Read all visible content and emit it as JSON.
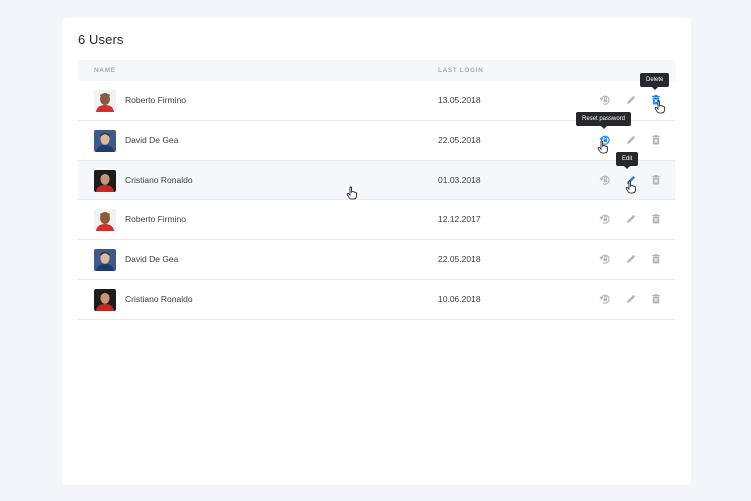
{
  "card": {
    "title": "6 Users"
  },
  "table": {
    "columns": {
      "name": "NAME",
      "last_login": "LAST LOGIN"
    },
    "rows": [
      {
        "name": "Roberto Firmino",
        "last_login": "13.05.2018"
      },
      {
        "name": "David De Gea",
        "last_login": "22.05.2018"
      },
      {
        "name": "Cristiano Ronaldo",
        "last_login": "01.03.2018"
      },
      {
        "name": "Roberto Firmino",
        "last_login": "12.12.2017"
      },
      {
        "name": "David De Gea",
        "last_login": "22.05.2018"
      },
      {
        "name": "Cristiano Ronaldo",
        "last_login": "10.06.2018"
      }
    ],
    "hover_row_index": 2
  },
  "tooltips": {
    "delete": "Delete",
    "reset_password": "Reset password",
    "edit": "Edit"
  },
  "icons": {
    "reset": "lock-reset-icon",
    "edit": "pencil-icon",
    "delete": "trash-icon"
  },
  "colors": {
    "icon_idle": "#b3b7c0",
    "icon_active": "#1e88e5",
    "tooltip_bg": "#26282d",
    "hover_row": "#f6f7fb"
  }
}
